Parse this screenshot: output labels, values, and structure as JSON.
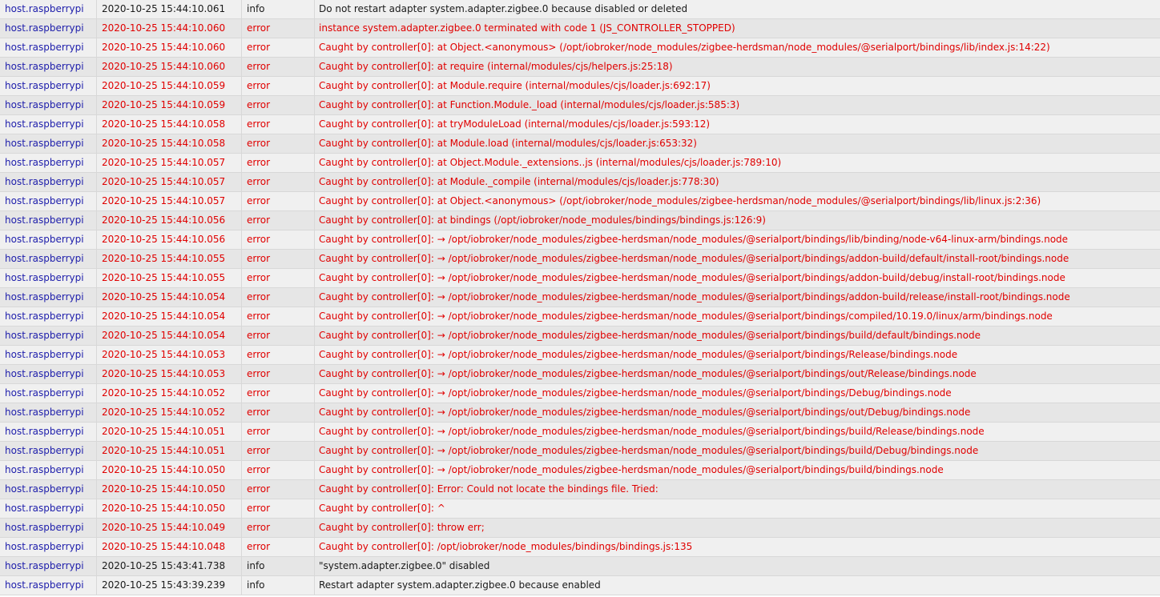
{
  "log": {
    "colors": {
      "source": "#1d1dab",
      "error": "#e00000",
      "info": "#1a1a1a"
    },
    "rows": [
      {
        "source": "host.raspberrypi",
        "time": "2020-10-25 15:44:10.061",
        "severity": "info",
        "message": "Do not restart adapter system.adapter.zigbee.0 because disabled or deleted"
      },
      {
        "source": "host.raspberrypi",
        "time": "2020-10-25 15:44:10.060",
        "severity": "error",
        "message": "instance system.adapter.zigbee.0 terminated with code 1 (JS_CONTROLLER_STOPPED)"
      },
      {
        "source": "host.raspberrypi",
        "time": "2020-10-25 15:44:10.060",
        "severity": "error",
        "message": "Caught by controller[0]: at Object.<anonymous> (/opt/iobroker/node_modules/zigbee-herdsman/node_modules/@serialport/bindings/lib/index.js:14:22)"
      },
      {
        "source": "host.raspberrypi",
        "time": "2020-10-25 15:44:10.060",
        "severity": "error",
        "message": "Caught by controller[0]: at require (internal/modules/cjs/helpers.js:25:18)"
      },
      {
        "source": "host.raspberrypi",
        "time": "2020-10-25 15:44:10.059",
        "severity": "error",
        "message": "Caught by controller[0]: at Module.require (internal/modules/cjs/loader.js:692:17)"
      },
      {
        "source": "host.raspberrypi",
        "time": "2020-10-25 15:44:10.059",
        "severity": "error",
        "message": "Caught by controller[0]: at Function.Module._load (internal/modules/cjs/loader.js:585:3)"
      },
      {
        "source": "host.raspberrypi",
        "time": "2020-10-25 15:44:10.058",
        "severity": "error",
        "message": "Caught by controller[0]: at tryModuleLoad (internal/modules/cjs/loader.js:593:12)"
      },
      {
        "source": "host.raspberrypi",
        "time": "2020-10-25 15:44:10.058",
        "severity": "error",
        "message": "Caught by controller[0]: at Module.load (internal/modules/cjs/loader.js:653:32)"
      },
      {
        "source": "host.raspberrypi",
        "time": "2020-10-25 15:44:10.057",
        "severity": "error",
        "message": "Caught by controller[0]: at Object.Module._extensions..js (internal/modules/cjs/loader.js:789:10)"
      },
      {
        "source": "host.raspberrypi",
        "time": "2020-10-25 15:44:10.057",
        "severity": "error",
        "message": "Caught by controller[0]: at Module._compile (internal/modules/cjs/loader.js:778:30)"
      },
      {
        "source": "host.raspberrypi",
        "time": "2020-10-25 15:44:10.057",
        "severity": "error",
        "message": "Caught by controller[0]: at Object.<anonymous> (/opt/iobroker/node_modules/zigbee-herdsman/node_modules/@serialport/bindings/lib/linux.js:2:36)"
      },
      {
        "source": "host.raspberrypi",
        "time": "2020-10-25 15:44:10.056",
        "severity": "error",
        "message": "Caught by controller[0]: at bindings (/opt/iobroker/node_modules/bindings/bindings.js:126:9)"
      },
      {
        "source": "host.raspberrypi",
        "time": "2020-10-25 15:44:10.056",
        "severity": "error",
        "message": "Caught by controller[0]: → /opt/iobroker/node_modules/zigbee-herdsman/node_modules/@serialport/bindings/lib/binding/node-v64-linux-arm/bindings.node"
      },
      {
        "source": "host.raspberrypi",
        "time": "2020-10-25 15:44:10.055",
        "severity": "error",
        "message": "Caught by controller[0]: → /opt/iobroker/node_modules/zigbee-herdsman/node_modules/@serialport/bindings/addon-build/default/install-root/bindings.node"
      },
      {
        "source": "host.raspberrypi",
        "time": "2020-10-25 15:44:10.055",
        "severity": "error",
        "message": "Caught by controller[0]: → /opt/iobroker/node_modules/zigbee-herdsman/node_modules/@serialport/bindings/addon-build/debug/install-root/bindings.node"
      },
      {
        "source": "host.raspberrypi",
        "time": "2020-10-25 15:44:10.054",
        "severity": "error",
        "message": "Caught by controller[0]: → /opt/iobroker/node_modules/zigbee-herdsman/node_modules/@serialport/bindings/addon-build/release/install-root/bindings.node"
      },
      {
        "source": "host.raspberrypi",
        "time": "2020-10-25 15:44:10.054",
        "severity": "error",
        "message": "Caught by controller[0]: → /opt/iobroker/node_modules/zigbee-herdsman/node_modules/@serialport/bindings/compiled/10.19.0/linux/arm/bindings.node"
      },
      {
        "source": "host.raspberrypi",
        "time": "2020-10-25 15:44:10.054",
        "severity": "error",
        "message": "Caught by controller[0]: → /opt/iobroker/node_modules/zigbee-herdsman/node_modules/@serialport/bindings/build/default/bindings.node"
      },
      {
        "source": "host.raspberrypi",
        "time": "2020-10-25 15:44:10.053",
        "severity": "error",
        "message": "Caught by controller[0]: → /opt/iobroker/node_modules/zigbee-herdsman/node_modules/@serialport/bindings/Release/bindings.node"
      },
      {
        "source": "host.raspberrypi",
        "time": "2020-10-25 15:44:10.053",
        "severity": "error",
        "message": "Caught by controller[0]: → /opt/iobroker/node_modules/zigbee-herdsman/node_modules/@serialport/bindings/out/Release/bindings.node"
      },
      {
        "source": "host.raspberrypi",
        "time": "2020-10-25 15:44:10.052",
        "severity": "error",
        "message": "Caught by controller[0]: → /opt/iobroker/node_modules/zigbee-herdsman/node_modules/@serialport/bindings/Debug/bindings.node"
      },
      {
        "source": "host.raspberrypi",
        "time": "2020-10-25 15:44:10.052",
        "severity": "error",
        "message": "Caught by controller[0]: → /opt/iobroker/node_modules/zigbee-herdsman/node_modules/@serialport/bindings/out/Debug/bindings.node"
      },
      {
        "source": "host.raspberrypi",
        "time": "2020-10-25 15:44:10.051",
        "severity": "error",
        "message": "Caught by controller[0]: → /opt/iobroker/node_modules/zigbee-herdsman/node_modules/@serialport/bindings/build/Release/bindings.node"
      },
      {
        "source": "host.raspberrypi",
        "time": "2020-10-25 15:44:10.051",
        "severity": "error",
        "message": "Caught by controller[0]: → /opt/iobroker/node_modules/zigbee-herdsman/node_modules/@serialport/bindings/build/Debug/bindings.node"
      },
      {
        "source": "host.raspberrypi",
        "time": "2020-10-25 15:44:10.050",
        "severity": "error",
        "message": "Caught by controller[0]: → /opt/iobroker/node_modules/zigbee-herdsman/node_modules/@serialport/bindings/build/bindings.node"
      },
      {
        "source": "host.raspberrypi",
        "time": "2020-10-25 15:44:10.050",
        "severity": "error",
        "message": "Caught by controller[0]: Error: Could not locate the bindings file. Tried:"
      },
      {
        "source": "host.raspberrypi",
        "time": "2020-10-25 15:44:10.050",
        "severity": "error",
        "message": "Caught by controller[0]: ^"
      },
      {
        "source": "host.raspberrypi",
        "time": "2020-10-25 15:44:10.049",
        "severity": "error",
        "message": "Caught by controller[0]: throw err;"
      },
      {
        "source": "host.raspberrypi",
        "time": "2020-10-25 15:44:10.048",
        "severity": "error",
        "message": "Caught by controller[0]: /opt/iobroker/node_modules/bindings/bindings.js:135"
      },
      {
        "source": "host.raspberrypi",
        "time": "2020-10-25 15:43:41.738",
        "severity": "info",
        "message": "\"system.adapter.zigbee.0\" disabled"
      },
      {
        "source": "host.raspberrypi",
        "time": "2020-10-25 15:43:39.239",
        "severity": "info",
        "message": "Restart adapter system.adapter.zigbee.0 because enabled"
      }
    ]
  }
}
